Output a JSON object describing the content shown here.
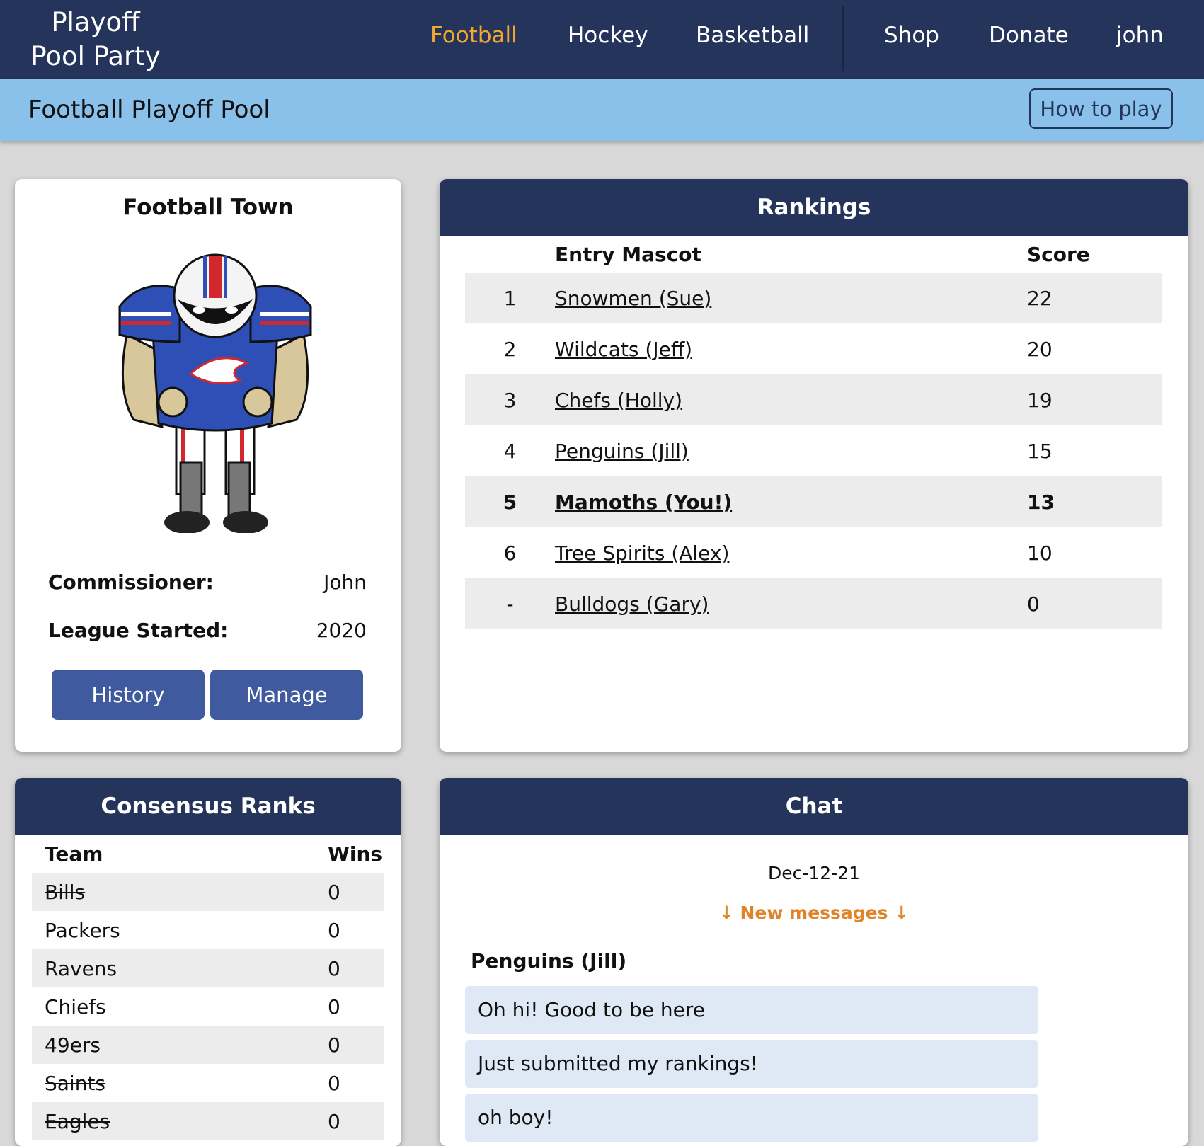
{
  "nav": {
    "brand_line1": "Playoff",
    "brand_line2": "Pool Party",
    "links": [
      "Football",
      "Hockey",
      "Basketball",
      "Shop",
      "Donate",
      "john"
    ],
    "active": "Football"
  },
  "subheader": {
    "title": "Football Playoff Pool",
    "how_to_play": "How to play"
  },
  "league": {
    "name": "Football Town",
    "commissioner_label": "Commissioner:",
    "commissioner": "John",
    "started_label": "League Started:",
    "started": "2020",
    "history_button": "History",
    "manage_button": "Manage"
  },
  "rankings": {
    "title": "Rankings",
    "col_mascot": "Entry Mascot",
    "col_score": "Score",
    "rows": [
      {
        "pos": "1",
        "name": "Snowmen (Sue)",
        "score": "22"
      },
      {
        "pos": "2",
        "name": "Wildcats (Jeff)",
        "score": "20"
      },
      {
        "pos": "3",
        "name": "Chefs (Holly)",
        "score": "19"
      },
      {
        "pos": "4",
        "name": "Penguins (Jill)",
        "score": "15"
      },
      {
        "pos": "5",
        "name": "Mamoths (You!)",
        "score": "13"
      },
      {
        "pos": "6",
        "name": "Tree Spirits (Alex)",
        "score": "10"
      },
      {
        "pos": "-",
        "name": "Bulldogs (Gary)",
        "score": "0"
      }
    ]
  },
  "consensus": {
    "title": "Consensus Ranks",
    "col_team": "Team",
    "col_wins": "Wins",
    "rows": [
      {
        "team": "Bills",
        "wins": "0",
        "eliminated": true
      },
      {
        "team": "Packers",
        "wins": "0",
        "eliminated": false
      },
      {
        "team": "Ravens",
        "wins": "0",
        "eliminated": false
      },
      {
        "team": "Chiefs",
        "wins": "0",
        "eliminated": false
      },
      {
        "team": "49ers",
        "wins": "0",
        "eliminated": false
      },
      {
        "team": "Saints",
        "wins": "0",
        "eliminated": true
      },
      {
        "team": "Eagles",
        "wins": "0",
        "eliminated": true
      }
    ]
  },
  "chat": {
    "title": "Chat",
    "date": "Dec-12-21",
    "new_messages": "↓ New messages ↓",
    "author": "Penguins (Jill)",
    "messages": [
      "Oh hi! Good to be here",
      "Just submitted my rankings!",
      "oh boy!"
    ]
  },
  "colors": {
    "nav_bg": "#25345a",
    "active_link": "#f0a733",
    "subheader_bg": "#8ac1ea",
    "button_bg": "#3f5a9e",
    "new_messages": "#e0832a",
    "bubble_bg": "#dfe9f5"
  },
  "icons": {
    "mascot": "football-player-mascot"
  }
}
